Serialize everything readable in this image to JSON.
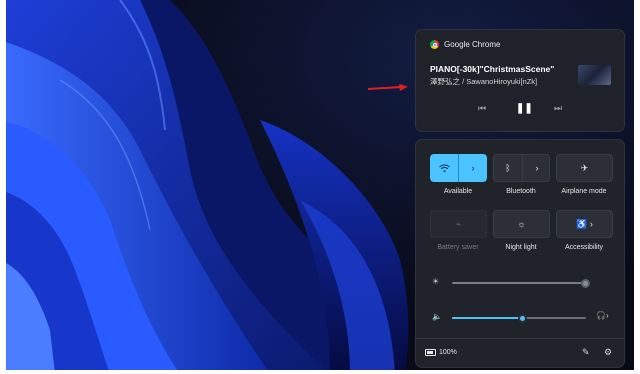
{
  "media": {
    "app_name": "Google Chrome",
    "title": "PIANO[-30k]\"ChristmasScene\"",
    "artist": "澤野弘之 / SawanoHiroyuki[nZk]",
    "prev_icon": "previous-track-icon",
    "pause_icon": "pause-icon",
    "next_icon": "next-track-icon"
  },
  "quick_settings": {
    "tiles": [
      {
        "label": "Available",
        "icon": "wifi-icon",
        "state": "on",
        "has_arrow": true
      },
      {
        "label": "Bluetooth",
        "icon": "bluetooth-icon",
        "state": "off",
        "has_arrow": true
      },
      {
        "label": "Airplane mode",
        "icon": "airplane-icon",
        "state": "off",
        "has_arrow": false
      },
      {
        "label": "Battery saver",
        "icon": "battery-saver-icon",
        "state": "disabled",
        "has_arrow": false
      },
      {
        "label": "Night light",
        "icon": "night-light-icon",
        "state": "off",
        "has_arrow": false
      },
      {
        "label": "Accessibility",
        "icon": "accessibility-icon",
        "state": "off",
        "has_arrow": true
      }
    ],
    "brightness": {
      "icon": "brightness-icon",
      "level": 1.0
    },
    "volume": {
      "icon": "speaker-icon",
      "level": 0.5,
      "output_icon": "headphones-icon"
    }
  },
  "footer": {
    "battery_percent": "100%",
    "edit_icon": "pencil-icon",
    "settings_icon": "gear-icon"
  },
  "colors": {
    "accent": "#4cc2ff",
    "annotation_arrow": "#e02020"
  }
}
